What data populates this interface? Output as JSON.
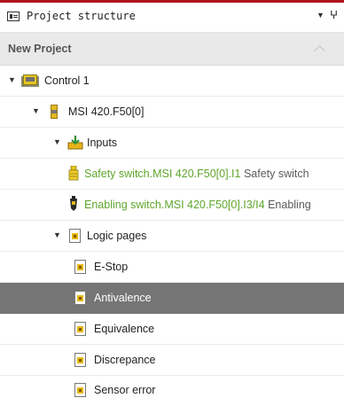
{
  "panel": {
    "title": "Project structure",
    "dropdown_glyph": "▼",
    "pin_glyph": "ⵖ"
  },
  "section": {
    "label": "New Project"
  },
  "tree": {
    "expand_glyph": "▼",
    "control": {
      "label": "Control 1",
      "icon": "control-icon"
    },
    "module": {
      "label": "MSI 420.F50[0]",
      "icon": "module-icon"
    },
    "inputs": {
      "label": "Inputs",
      "icon": "inputs-icon"
    },
    "input_items": [
      {
        "name": "Safety switch.MSI 420.F50[0].I1",
        "desc": "Safety switch",
        "icon": "safety-switch-icon"
      },
      {
        "name": "Enabling switch.MSI 420.F50[0].I3/I4",
        "desc": "Enabling",
        "icon": "enabling-switch-icon"
      }
    ],
    "logic": {
      "label": "Logic pages",
      "icon": "logic-pages-icon"
    },
    "pages": [
      {
        "label": "E-Stop",
        "selected": false
      },
      {
        "label": "Antivalence",
        "selected": true
      },
      {
        "label": "Equivalence",
        "selected": false
      },
      {
        "label": "Discrepance",
        "selected": false
      },
      {
        "label": "Sensor error",
        "selected": false
      }
    ]
  },
  "colors": {
    "accent_top": "#b0131e",
    "selected_bg": "#757575",
    "signal_green": "#5ea52b"
  }
}
